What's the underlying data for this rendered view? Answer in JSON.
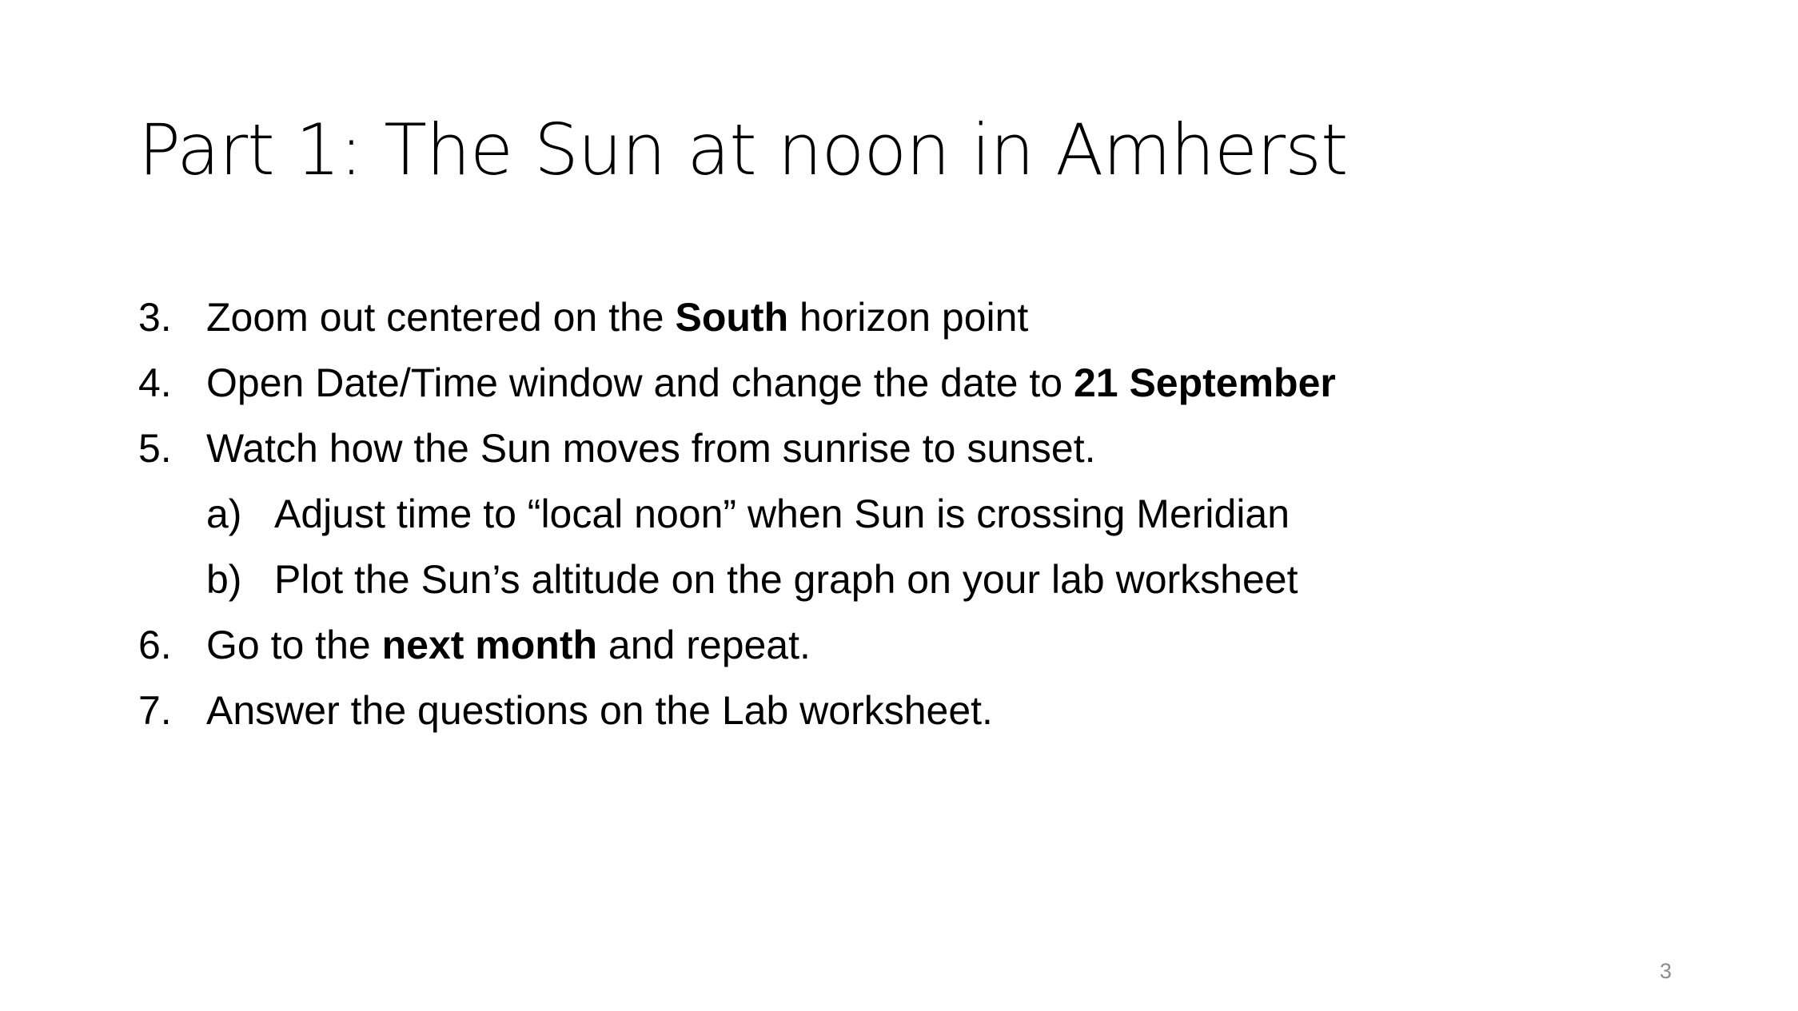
{
  "slide": {
    "title": "Part 1: The Sun at noon in Amherst",
    "page_number": "3",
    "items": [
      {
        "num": "3.",
        "pre": "Zoom out centered on the ",
        "bold": "South",
        "post": " horizon point"
      },
      {
        "num": "4.",
        "pre": "Open Date/Time window and change the date to ",
        "bold": "21 September",
        "post": ""
      },
      {
        "num": "5.",
        "pre": "Watch how the Sun moves from sunrise to sunset.",
        "bold": "",
        "post": ""
      },
      {
        "num": "a)",
        "pre": "Adjust time to “local noon” when Sun is crossing Meridian",
        "bold": "",
        "post": ""
      },
      {
        "num": "b)",
        "pre": "Plot the Sun’s altitude on the graph on your lab worksheet",
        "bold": "",
        "post": ""
      },
      {
        "num": "6.",
        "pre": "Go to the ",
        "bold": "next month",
        "post": " and repeat."
      },
      {
        "num": "7.",
        "pre": "Answer the questions on the Lab worksheet.",
        "bold": "",
        "post": ""
      }
    ]
  }
}
